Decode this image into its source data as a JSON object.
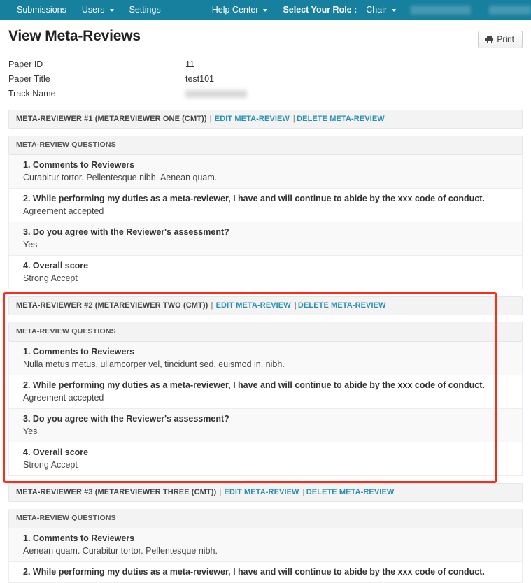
{
  "navbar": {
    "items": [
      {
        "label": "Submissions",
        "caret": false,
        "bold": false
      },
      {
        "label": "Users",
        "caret": true,
        "bold": false
      },
      {
        "label": "Settings",
        "caret": false,
        "bold": false
      }
    ],
    "right_items": [
      {
        "label": "Help Center",
        "caret": true,
        "bold": false
      },
      {
        "label": "Select Your Role :",
        "caret": false,
        "bold": true
      },
      {
        "label": "Chair",
        "caret": true,
        "bold": false
      }
    ],
    "redacted_blocks": 2,
    "background_color": "#17809f"
  },
  "header": {
    "title": "View Meta-Reviews",
    "print_label": "Print"
  },
  "paper_info": [
    {
      "label": "Paper ID",
      "value": "11",
      "redacted": false
    },
    {
      "label": "Paper Title",
      "value": "test101",
      "redacted": false
    },
    {
      "label": "Track Name",
      "value": "",
      "redacted": true
    }
  ],
  "common": {
    "questions_bar_label": "META-REVIEW QUESTIONS",
    "edit_link": "EDIT META-REVIEW",
    "delete_link": "DELETE META-REVIEW",
    "separator": "|"
  },
  "highlight": {
    "color": "#ff2b18",
    "target_block_index": 1
  },
  "reviewers": [
    {
      "header": "META-REVIEWER #1 (METAREVIEWER ONE (CMT))",
      "questions": [
        {
          "q": "1. Comments to Reviewers",
          "a": "Curabitur tortor. Pellentesque nibh. Aenean quam."
        },
        {
          "q": "2. While performing my duties as a meta-reviewer, I have and will continue to abide by the xxx code of conduct.",
          "a": "Agreement accepted"
        },
        {
          "q": "3. Do you agree with the Reviewer's assessment?",
          "a": "Yes"
        },
        {
          "q": "4. Overall score",
          "a": "Strong Accept"
        }
      ]
    },
    {
      "header": "META-REVIEWER #2 (METAREVIEWER TWO (CMT))",
      "questions": [
        {
          "q": "1. Comments to Reviewers",
          "a": "Nulla metus metus, ullamcorper vel, tincidunt sed, euismod in, nibh."
        },
        {
          "q": "2. While performing my duties as a meta-reviewer, I have and will continue to abide by the xxx code of conduct.",
          "a": "Agreement accepted"
        },
        {
          "q": "3. Do you agree with the Reviewer's assessment?",
          "a": "Yes"
        },
        {
          "q": "4. Overall score",
          "a": "Strong Accept"
        }
      ]
    },
    {
      "header": "META-REVIEWER #3 (METAREVIEWER THREE (CMT))",
      "questions": [
        {
          "q": "1. Comments to Reviewers",
          "a": "Aenean quam. Curabitur tortor. Pellentesque nibh."
        },
        {
          "q": "2. While performing my duties as a meta-reviewer, I have and will continue to abide by the xxx code of conduct.",
          "a": ""
        }
      ]
    }
  ]
}
